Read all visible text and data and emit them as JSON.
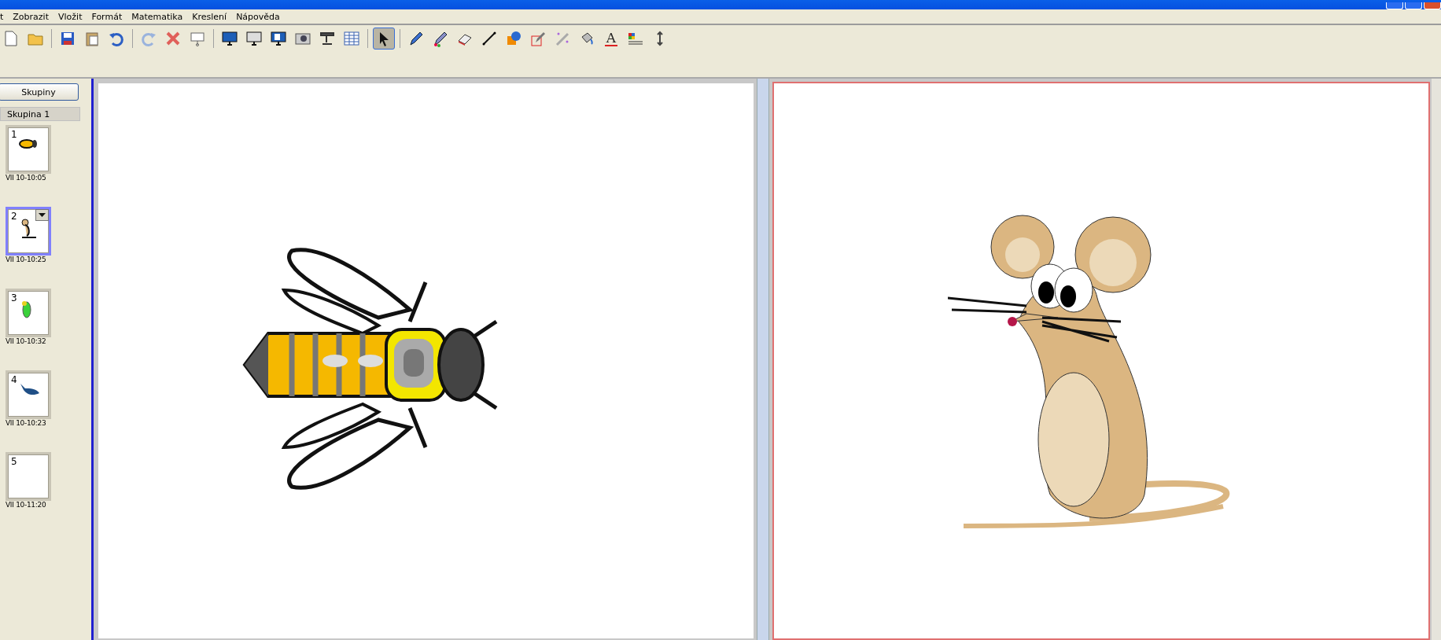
{
  "menu": [
    {
      "label": "t"
    },
    {
      "label": "Zobrazit"
    },
    {
      "label": "Vložit"
    },
    {
      "label": "Formát"
    },
    {
      "label": "Matematika"
    },
    {
      "label": "Kreslení"
    },
    {
      "label": "Nápověda"
    }
  ],
  "toolbar": [
    {
      "selected": false
    },
    {
      "selected": false
    },
    {
      "selected": false
    },
    {
      "selected": false
    },
    {
      "selected": false
    },
    {
      "selected": false
    },
    {
      "selected": false
    },
    {
      "selected": false
    },
    {
      "selected": false
    },
    {
      "selected": false
    },
    {
      "selected": false
    },
    {
      "selected": false
    },
    {
      "selected": false
    },
    {
      "selected": false
    },
    {
      "selected": true
    },
    {
      "selected": false
    },
    {
      "selected": false
    },
    {
      "selected": false
    },
    {
      "selected": false
    },
    {
      "selected": false
    },
    {
      "selected": false
    },
    {
      "selected": false
    },
    {
      "selected": false
    },
    {
      "selected": false,
      "label": "A"
    },
    {
      "selected": false
    },
    {
      "selected": false
    }
  ],
  "sidebar": {
    "button": "Skupiny",
    "group": "Skupina 1",
    "pages": [
      {
        "number": "1",
        "time": "VII 10-10:05",
        "selected": false
      },
      {
        "number": "2",
        "time": "VII 10-10:25",
        "selected": true
      },
      {
        "number": "3",
        "time": "VII 10-10:32",
        "selected": false
      },
      {
        "number": "4",
        "time": "VII 10-10:23",
        "selected": false
      },
      {
        "number": "5",
        "time": "VII 10-11:20",
        "selected": false
      }
    ]
  },
  "pages": [
    {
      "selected": false
    },
    {
      "selected": true
    }
  ]
}
